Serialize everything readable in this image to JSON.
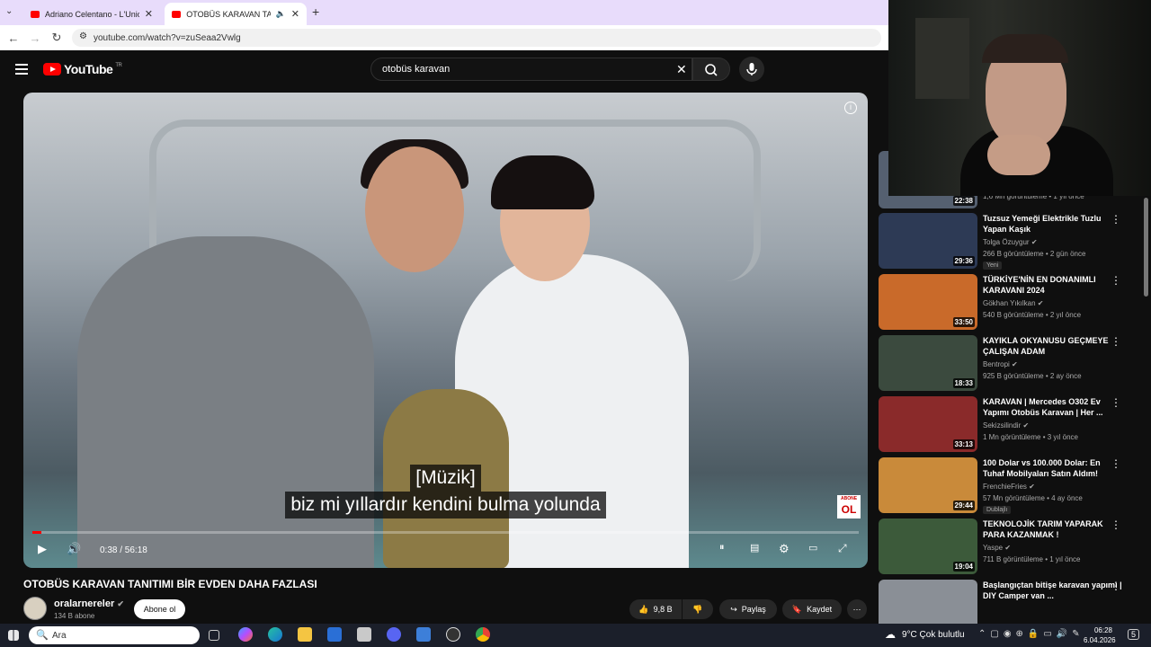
{
  "browser": {
    "tabs": [
      {
        "title": "Adriano Celentano - L'Unica Ch",
        "active": false
      },
      {
        "title": "OTOBÜS KARAVAN TANITIM",
        "active": true
      }
    ],
    "url": "youtube.com/watch?v=zuSeaa2Vwlg"
  },
  "youtube": {
    "logo_text": "YouTube",
    "logo_region": "TR",
    "search_query": "otobüs karavan"
  },
  "player": {
    "caption_line1": "[Müzik]",
    "caption_line2": "biz mi yıllardır kendini bulma yolunda",
    "time": "0:38 / 56:18",
    "progress_fraction": 0.011,
    "watermark_top": "ABONE",
    "watermark_bottom": "OL"
  },
  "video": {
    "title": "OTOBÜS KARAVAN TANITIMI BİR EVDEN DAHA FAZLASI",
    "channel": "oralarnereler",
    "subscribers": "134 B abone",
    "subscribe_label": "Abone ol",
    "likes": "9,8 B",
    "share_label": "Paylaş",
    "save_label": "Kaydet"
  },
  "sidebar": {
    "partial_meta": "1,6 Mn görüntüleme • 1 yıl önce",
    "partial_duration": "22:38",
    "items": [
      {
        "title": "Tuzsuz Yemeği Elektrikle Tuzlu Yapan Kaşık",
        "channel": "Tolga Özuygur",
        "meta": "266 B görüntüleme • 2 gün önce",
        "duration": "29:36",
        "badge": "Yeni",
        "color": "#2d3a55"
      },
      {
        "title": "TÜRKİYE'NİN EN DONANIMLI KARAVANI 2024",
        "channel": "Gökhan Yıkılkan",
        "meta": "540 B görüntüleme • 2 yıl önce",
        "duration": "33:50",
        "badge": "",
        "color": "#c96a2a"
      },
      {
        "title": "KAYIKLA OKYANUSU GEÇMEYE ÇALIŞAN ADAM",
        "channel": "Bentropi",
        "meta": "925 B görüntüleme • 2 ay önce",
        "duration": "18:33",
        "badge": "",
        "color": "#3b4a3e"
      },
      {
        "title": "KARAVAN | Mercedes O302 Ev Yapımı Otobüs Karavan | Her ...",
        "channel": "Sekizsilindir",
        "meta": "1 Mn görüntüleme • 3 yıl önce",
        "duration": "33:13",
        "badge": "",
        "color": "#8a2a2a"
      },
      {
        "title": "100 Dolar vs 100.000 Dolar: En Tuhaf Mobilyaları Satın Aldım!",
        "channel": "FrenchieFries",
        "meta": "57 Mn görüntüleme • 4 ay önce",
        "duration": "29:44",
        "badge": "Dublajlı",
        "color": "#c98a3a"
      },
      {
        "title": "TEKNOLOJİK TARIM YAPARAK PARA KAZANMAK !",
        "channel": "Yaspe",
        "meta": "711 B görüntüleme • 1 yıl önce",
        "duration": "19:04",
        "badge": "",
        "color": "#3c5a3a"
      },
      {
        "title": "Başlangıçtan bitişe karavan yapımı | DIY Camper van ...",
        "channel": "",
        "meta": "",
        "duration": "",
        "badge": "",
        "color": "#8a8f96"
      }
    ]
  },
  "taskbar": {
    "search_placeholder": "Ara",
    "weather": "9°C  Çok bulutlu",
    "time": "06:28",
    "date": "6.04.2026",
    "notification_count": "5"
  }
}
